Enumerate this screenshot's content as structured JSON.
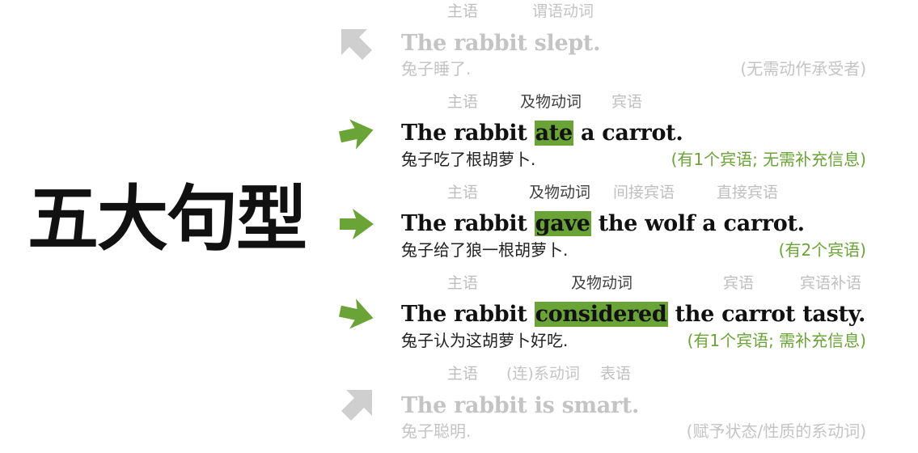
{
  "title": "五大句型",
  "colors": {
    "accent": "#6aa336",
    "faded": "#c4c4c4",
    "text": "#111111"
  },
  "rows": [
    {
      "state": "faded",
      "arrow_icon": "arrow-up-left-icon",
      "labels": [
        "主语",
        "谓语动词"
      ],
      "sentence": {
        "pre": "The rabbit slept.",
        "verb": "",
        "post": ""
      },
      "translation": "兔子睡了.",
      "note": "(无需动作承受者)"
    },
    {
      "state": "active",
      "arrow_icon": "arrow-right-icon",
      "labels": [
        "主语",
        "及物动词",
        "宾语"
      ],
      "sentence": {
        "pre": "The rabbit ",
        "verb": "ate",
        "post": " a carrot."
      },
      "translation": "兔子吃了根胡萝卜.",
      "note": "(有1个宾语; 无需补充信息)"
    },
    {
      "state": "active",
      "arrow_icon": "arrow-right-icon",
      "labels": [
        "主语",
        "及物动词",
        "间接宾语",
        "直接宾语"
      ],
      "sentence": {
        "pre": "The rabbit ",
        "verb": "gave",
        "post": " the wolf a carrot."
      },
      "translation": "兔子给了狼一根胡萝卜.",
      "note": "(有2个宾语)"
    },
    {
      "state": "active",
      "arrow_icon": "arrow-right-icon",
      "labels": [
        "主语",
        "及物动词",
        "宾语",
        "宾语补语"
      ],
      "sentence": {
        "pre": "The rabbit ",
        "verb": "considered",
        "post": " the carrot tasty."
      },
      "translation": "兔子认为这胡萝卜好吃.",
      "note": "(有1个宾语; 需补充信息)"
    },
    {
      "state": "faded",
      "arrow_icon": "arrow-down-left-icon",
      "labels": [
        "主语",
        "(连)系动词",
        "表语"
      ],
      "sentence": {
        "pre": "The rabbit is smart.",
        "verb": "",
        "post": ""
      },
      "translation": "兔子聪明.",
      "note": "(赋予状态/性质的系动词)"
    }
  ]
}
